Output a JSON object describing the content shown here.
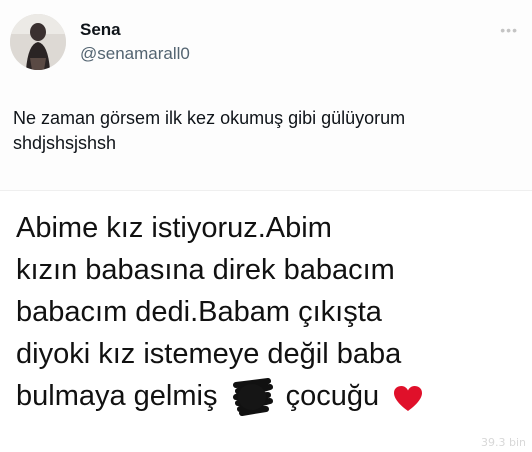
{
  "post": {
    "author_name": "Sena",
    "author_handle": "@senamarall0",
    "more_icon": "ellipsis-icon",
    "text_lines": [
      "Ne zaman görsem ilk kez okumuş gibi gülüyorum",
      "shdjshsjshsh"
    ]
  },
  "image": {
    "lines": [
      "Abime kız istiyoruz.Abim",
      "kızın babasına direk babacım",
      "babacım dedi.Babam çıkışta",
      "diyoki kız istemeye değil baba"
    ],
    "last_line_before": "bulmaya gelmiş",
    "last_line_after": "çocuğu",
    "censor_icon": "scribble-censor-icon",
    "heart_icon": "red-heart-icon",
    "heart_color": "#e0102a",
    "views_watermark": "39.3 bin"
  }
}
